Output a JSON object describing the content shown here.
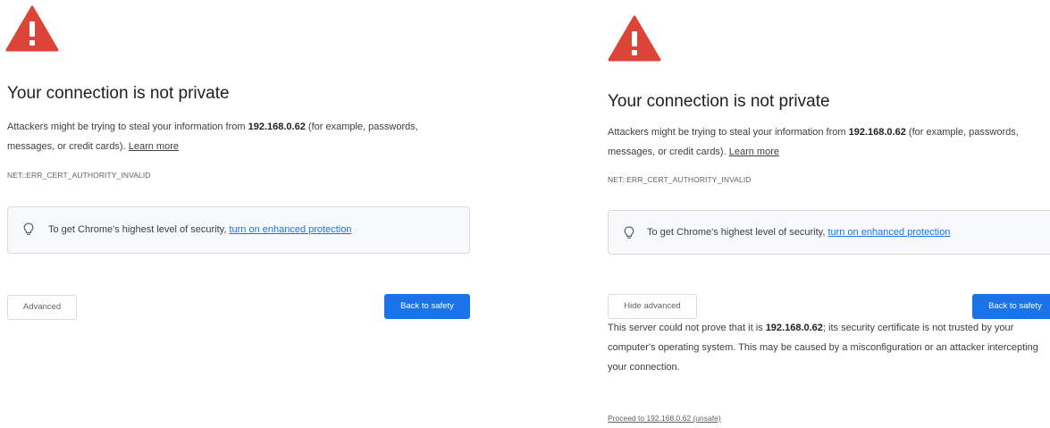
{
  "colors": {
    "warning_red": "#db4437",
    "primary_blue": "#1a73e8",
    "box_background": "#f8f9fa",
    "border_gray": "#dadce0"
  },
  "left": {
    "heading": "Your connection is not private",
    "description": {
      "before_host": "Attackers might be trying to steal your information from ",
      "host": "192.168.0.62",
      "after_host": " (for example, passwords, messages, or credit cards). ",
      "learn_more": "Learn more"
    },
    "error_code": "NET::ERR_CERT_AUTHORITY_INVALID",
    "enhanced": {
      "icon": "lightbulb-icon",
      "text": "To get Chrome's highest level of security, ",
      "link": "turn on enhanced protection"
    },
    "advanced_button": "Advanced",
    "back_button": "Back to safety"
  },
  "right": {
    "heading": "Your connection is not private",
    "description": {
      "before_host": "Attackers might be trying to steal your information from ",
      "host": "192.168.0.62",
      "after_host": " (for example, passwords, messages, or credit cards). ",
      "learn_more": "Learn more"
    },
    "error_code": "NET::ERR_CERT_AUTHORITY_INVALID",
    "enhanced": {
      "icon": "lightbulb-icon",
      "text": "To get Chrome's highest level of security, ",
      "link": "turn on enhanced protection"
    },
    "hide_advanced_button": "Hide advanced",
    "back_button": "Back to safety",
    "details": {
      "before_host": "This server could not prove that it is ",
      "host": "192.168.0.62",
      "after_host": "; its security certificate is not trusted by your computer's operating system. This may be caused by a misconfiguration or an attacker intercepting your connection."
    },
    "proceed_link": "Proceed to 192.168.0.62 (unsafe)"
  }
}
